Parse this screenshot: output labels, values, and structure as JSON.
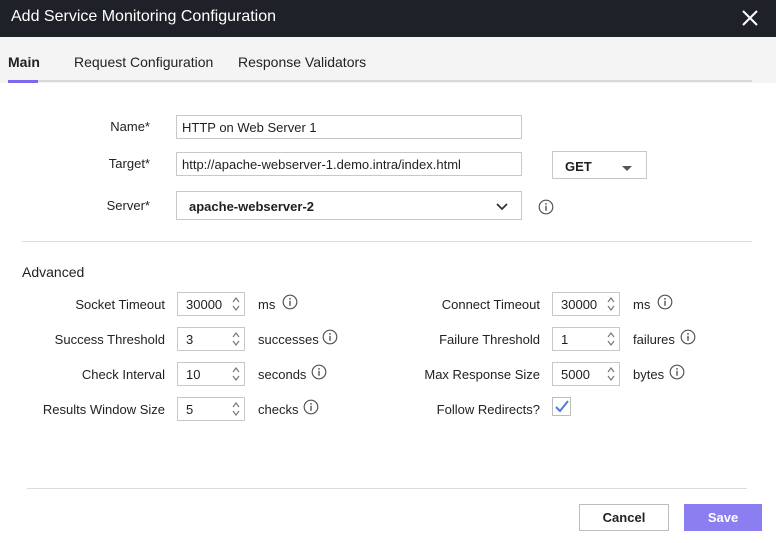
{
  "dialog": {
    "title": "Add Service Monitoring Configuration"
  },
  "tabs": [
    {
      "label": "Main"
    },
    {
      "label": "Request Configuration"
    },
    {
      "label": "Response Validators"
    }
  ],
  "form": {
    "name": {
      "label": "Name*",
      "value": "HTTP on Web Server 1"
    },
    "target": {
      "label": "Target*",
      "value": "http://apache-webserver-1.demo.intra/index.html"
    },
    "method": {
      "value": "GET"
    },
    "server": {
      "label": "Server*",
      "value": "apache-webserver-2"
    }
  },
  "advanced": {
    "title": "Advanced",
    "left": [
      {
        "label": "Socket Timeout",
        "value": "30000",
        "unit": "ms"
      },
      {
        "label": "Success Threshold",
        "value": "3",
        "unit": "successes"
      },
      {
        "label": "Check Interval",
        "value": "10",
        "unit": "seconds"
      },
      {
        "label": "Results Window Size",
        "value": "5",
        "unit": "checks"
      }
    ],
    "right": [
      {
        "label": "Connect Timeout",
        "value": "30000",
        "unit": "ms"
      },
      {
        "label": "Failure Threshold",
        "value": "1",
        "unit": "failures"
      },
      {
        "label": "Max Response Size",
        "value": "5000",
        "unit": "bytes"
      },
      {
        "label": "Follow Redirects?",
        "checked": true
      }
    ]
  },
  "footer": {
    "cancel_label": "Cancel",
    "save_label": "Save"
  },
  "colors": {
    "accent": "#8a7ef0",
    "titlebar": "#1e2127"
  },
  "icons": [
    "close-icon",
    "chevron-down-icon",
    "info-icon",
    "spinner-arrows-icon",
    "checkmark-icon"
  ]
}
